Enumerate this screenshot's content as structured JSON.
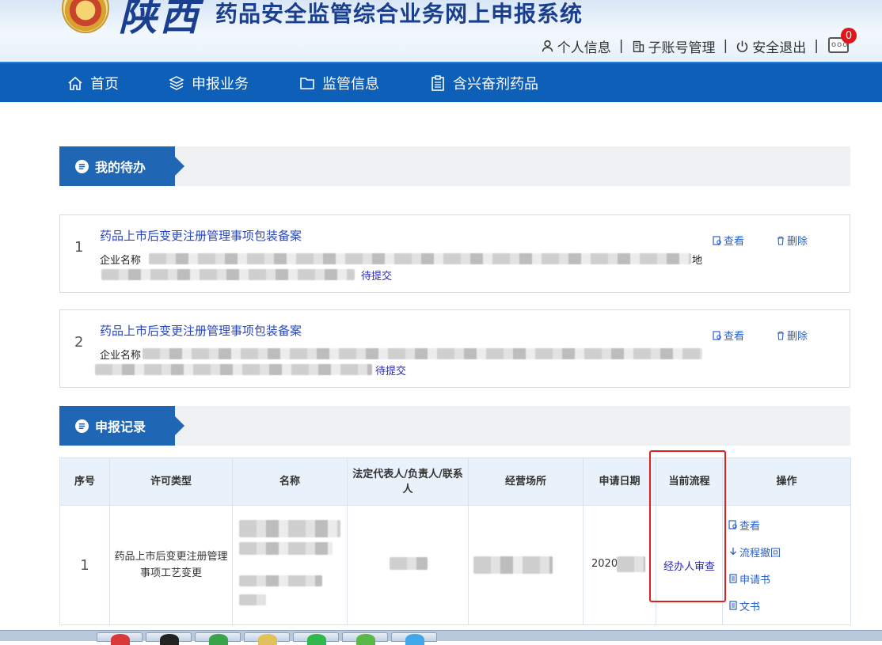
{
  "header": {
    "title_big": "陕西",
    "title_sub": "药品安全监管综合业务网上申报系统",
    "links": [
      {
        "label": "个人信息",
        "icon": "user-icon"
      },
      {
        "label": "子账号管理",
        "icon": "building-icon"
      },
      {
        "label": "安全退出",
        "icon": "power-icon"
      }
    ],
    "message_count": "0"
  },
  "nav": {
    "items": [
      {
        "label": "首页",
        "icon": "home-icon"
      },
      {
        "label": "申报业务",
        "icon": "layers-icon"
      },
      {
        "label": "监管信息",
        "icon": "folder-icon"
      },
      {
        "label": "含兴奋剂药品",
        "icon": "clipboard-icon"
      }
    ]
  },
  "todo": {
    "section_title": "我的待办",
    "items": [
      {
        "num": "1",
        "title": "药品上市后变更注册管理事项包装备案",
        "company_label": "企业名称",
        "tail": "地",
        "status": "待提交",
        "view": "查看",
        "delete": "删除"
      },
      {
        "num": "2",
        "title": "药品上市后变更注册管理事项包装备案",
        "company_label": "企业名称",
        "tail": "",
        "status": "待提交",
        "view": "查看",
        "delete": "删除"
      }
    ]
  },
  "records": {
    "section_title": "申报记录",
    "columns": [
      "序号",
      "许可类型",
      "名称",
      "法定代表人/负责人/联系人",
      "经营场所",
      "申请日期",
      "当前流程",
      "操作"
    ],
    "rows": [
      {
        "seq": "1",
        "type": "药品上市后变更注册管理事项工艺变更",
        "date": "2020",
        "flow": "经办人审查",
        "actions": [
          "查看",
          "流程撤回",
          "申请书",
          "文书"
        ]
      }
    ]
  },
  "colors": {
    "nav_bg": "#0d5fb8",
    "accent": "#1f66b5",
    "link": "#2a62c9",
    "highlight": "#e02020"
  }
}
